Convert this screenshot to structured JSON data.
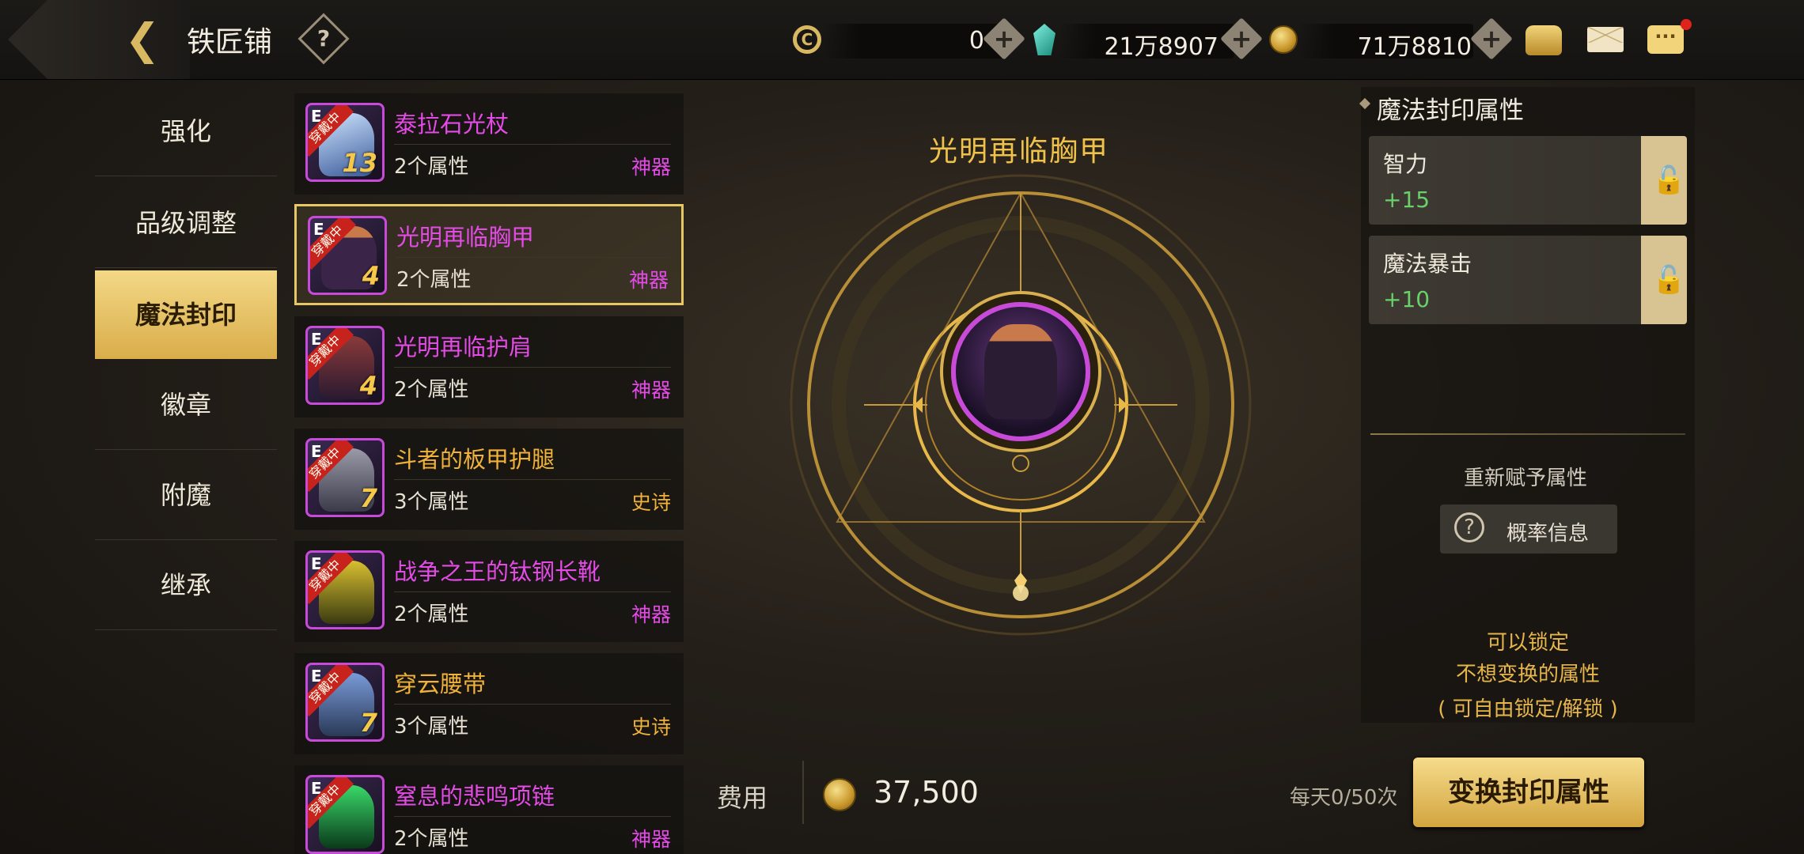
{
  "header": {
    "title": "铁匠铺",
    "help_icon": "?",
    "currencies": [
      {
        "icon": "c-coin-icon",
        "value": "0"
      },
      {
        "icon": "green-gem-icon",
        "value": "21万8907"
      },
      {
        "icon": "gold-coin-icon",
        "value": "71万8810"
      }
    ],
    "plus_label": "+",
    "chat_icon": "···"
  },
  "tabs": [
    {
      "label": "强化"
    },
    {
      "label": "品级调整"
    },
    {
      "label": "魔法封印",
      "active": true
    },
    {
      "label": "徽章"
    },
    {
      "label": "附魔"
    },
    {
      "label": "继承"
    }
  ],
  "item_common": {
    "equipped_label": "穿戴中",
    "grade_label": "E"
  },
  "items": [
    {
      "name": "泰拉石光杖",
      "attrs": "2个属性",
      "rarity": "神器",
      "level": "13",
      "color": "#e44ae6"
    },
    {
      "name": "光明再临胸甲",
      "attrs": "2个属性",
      "rarity": "神器",
      "level": "4",
      "color": "#e44ae6",
      "selected": true
    },
    {
      "name": "光明再临护肩",
      "attrs": "2个属性",
      "rarity": "神器",
      "level": "4",
      "color": "#e44ae6"
    },
    {
      "name": "斗者的板甲护腿",
      "attrs": "3个属性",
      "rarity": "史诗",
      "level": "7",
      "color": "#f0b23a"
    },
    {
      "name": "战争之王的钛钢长靴",
      "attrs": "2个属性",
      "rarity": "神器",
      "level": "",
      "color": "#e44ae6"
    },
    {
      "name": "穿云腰带",
      "attrs": "3个属性",
      "rarity": "史诗",
      "level": "7",
      "color": "#f0b23a"
    },
    {
      "name": "窒息的悲鸣项链",
      "attrs": "2个属性",
      "rarity": "神器",
      "level": "",
      "color": "#e44ae6"
    }
  ],
  "center": {
    "equipment_name": "光明再临胸甲",
    "cost_label": "费用",
    "cost_value": "37,500",
    "daily_limit": "每天0/50次",
    "change_button": "变换封印属性"
  },
  "right_panel": {
    "title": "魔法封印属性",
    "attributes": [
      {
        "name": "智力",
        "value": "+15"
      },
      {
        "name": "魔法暴击",
        "value": "+10"
      }
    ],
    "reassign_label": "重新赋予属性",
    "probability_button": "概率信息",
    "note_lines": [
      "可以锁定",
      "不想变换的属性",
      "( 可自由锁定/解锁 )"
    ]
  },
  "colors": {
    "accent_gold": "#e6c763",
    "artifact_pink": "#e44ae6",
    "epic_orange": "#f0b23a",
    "stat_green": "#6ad06a"
  }
}
